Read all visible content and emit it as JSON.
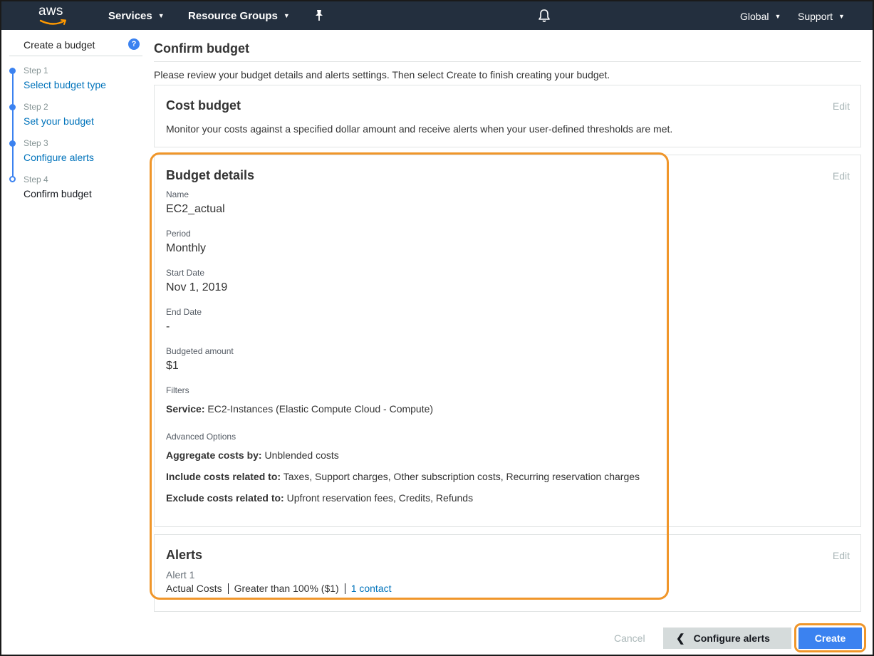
{
  "nav": {
    "logo": "aws",
    "services": "Services",
    "resource_groups": "Resource Groups",
    "region": "Global",
    "support": "Support"
  },
  "sidebar": {
    "title": "Create a budget",
    "steps": [
      {
        "label": "Step 1",
        "name": "Select budget type",
        "state": "done"
      },
      {
        "label": "Step 2",
        "name": "Set your budget",
        "state": "done"
      },
      {
        "label": "Step 3",
        "name": "Configure alerts",
        "state": "done"
      },
      {
        "label": "Step 4",
        "name": "Confirm budget",
        "state": "current"
      }
    ]
  },
  "main": {
    "title": "Confirm budget",
    "intro": "Please review your budget details and alerts settings. Then select Create to finish creating your budget.",
    "edit_label": "Edit",
    "cost_budget": {
      "title": "Cost budget",
      "description": "Monitor your costs against a specified dollar amount and receive alerts when your user-defined thresholds are met."
    },
    "details": {
      "title": "Budget details",
      "name_label": "Name",
      "name_value": "EC2_actual",
      "period_label": "Period",
      "period_value": "Monthly",
      "start_label": "Start Date",
      "start_value": "Nov 1, 2019",
      "end_label": "End Date",
      "end_value": "-",
      "amount_label": "Budgeted amount",
      "amount_value": "$1",
      "filters_label": "Filters",
      "service_key": "Service:",
      "service_value": "EC2-Instances (Elastic Compute Cloud - Compute)",
      "advanced_label": "Advanced Options",
      "aggregate_key": "Aggregate costs by:",
      "aggregate_value": "Unblended costs",
      "include_key": "Include costs related to:",
      "include_value": "Taxes, Support charges, Other subscription costs, Recurring reservation charges",
      "exclude_key": "Exclude costs related to:",
      "exclude_value": "Upfront reservation fees, Credits, Refunds"
    },
    "alerts": {
      "title": "Alerts",
      "alert_name": "Alert 1",
      "type": "Actual Costs",
      "threshold": "Greater than 100% ($1)",
      "contacts": "1 contact"
    }
  },
  "footer": {
    "cancel": "Cancel",
    "back": "Configure alerts",
    "create": "Create"
  },
  "colors": {
    "nav_bg": "#232f3e",
    "accent_blue": "#3b82f0",
    "highlight_orange": "#f0962a",
    "link": "#0073bb"
  }
}
